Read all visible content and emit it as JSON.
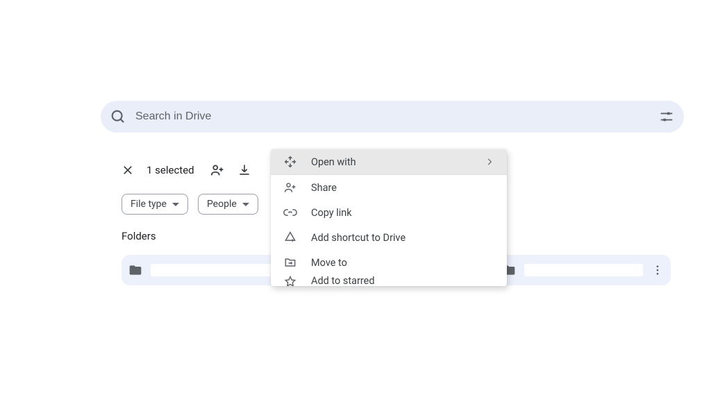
{
  "search": {
    "placeholder": "Search in Drive"
  },
  "selection": {
    "count_label": "1 selected"
  },
  "chips": {
    "file_type": "File type",
    "people": "People"
  },
  "sections": {
    "folders": "Folders"
  },
  "context_menu": {
    "open_with": "Open with",
    "share": "Share",
    "copy_link": "Copy link",
    "add_shortcut": "Add shortcut to Drive",
    "move_to": "Move to",
    "add_to_starred": "Add to starred"
  }
}
